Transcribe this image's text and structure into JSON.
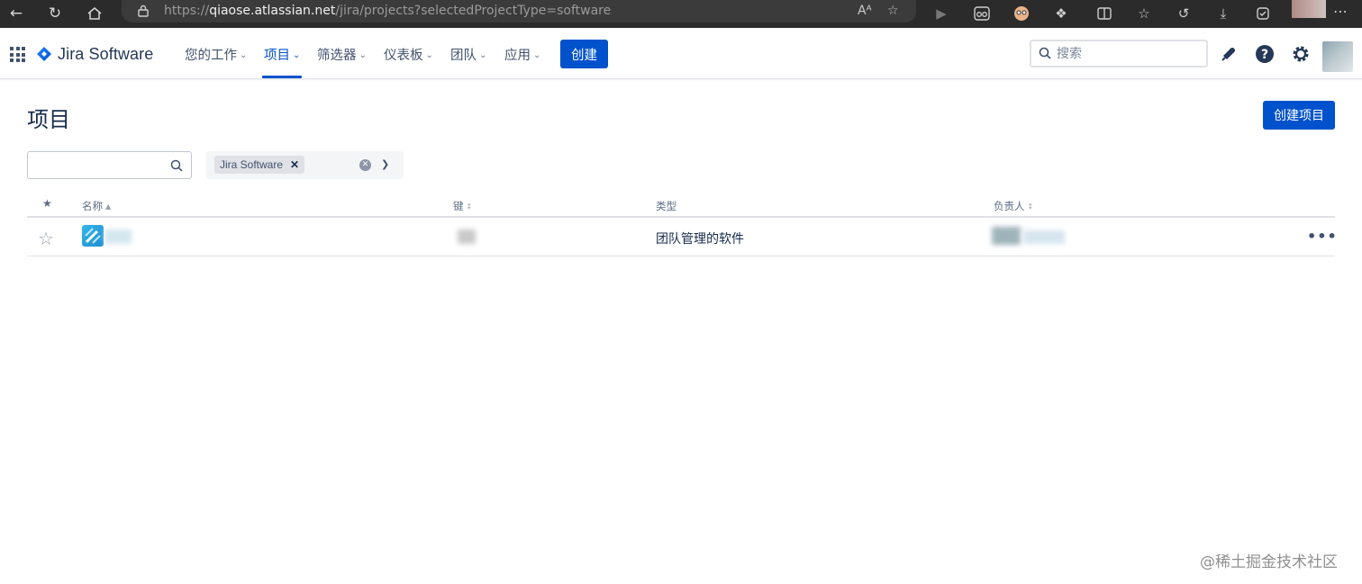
{
  "browser": {
    "url_scheme": "https://",
    "url_host": "qiaose.atlassian.net",
    "url_path": "/jira/projects?selectedProjectType=software",
    "read_aloud_label": "Aᴬ"
  },
  "header": {
    "logo_text": "Jira Software",
    "nav": [
      {
        "label": "您的工作"
      },
      {
        "label": "项目"
      },
      {
        "label": "筛选器"
      },
      {
        "label": "仪表板"
      },
      {
        "label": "团队"
      },
      {
        "label": "应用"
      }
    ],
    "create_label": "创建",
    "search_placeholder": "搜索",
    "colors": {
      "brand": "#0052cc"
    }
  },
  "page": {
    "title": "项目",
    "create_project_label": "创建项目",
    "filter_placeholder": "",
    "type_filter_tag": "Jira Software"
  },
  "table": {
    "columns": {
      "star": "★",
      "name": "名称",
      "key": "键",
      "type": "类型",
      "lead": "负责人"
    },
    "rows": [
      {
        "type": "团队管理的软件"
      }
    ]
  },
  "watermark": "@稀土掘金技术社区"
}
